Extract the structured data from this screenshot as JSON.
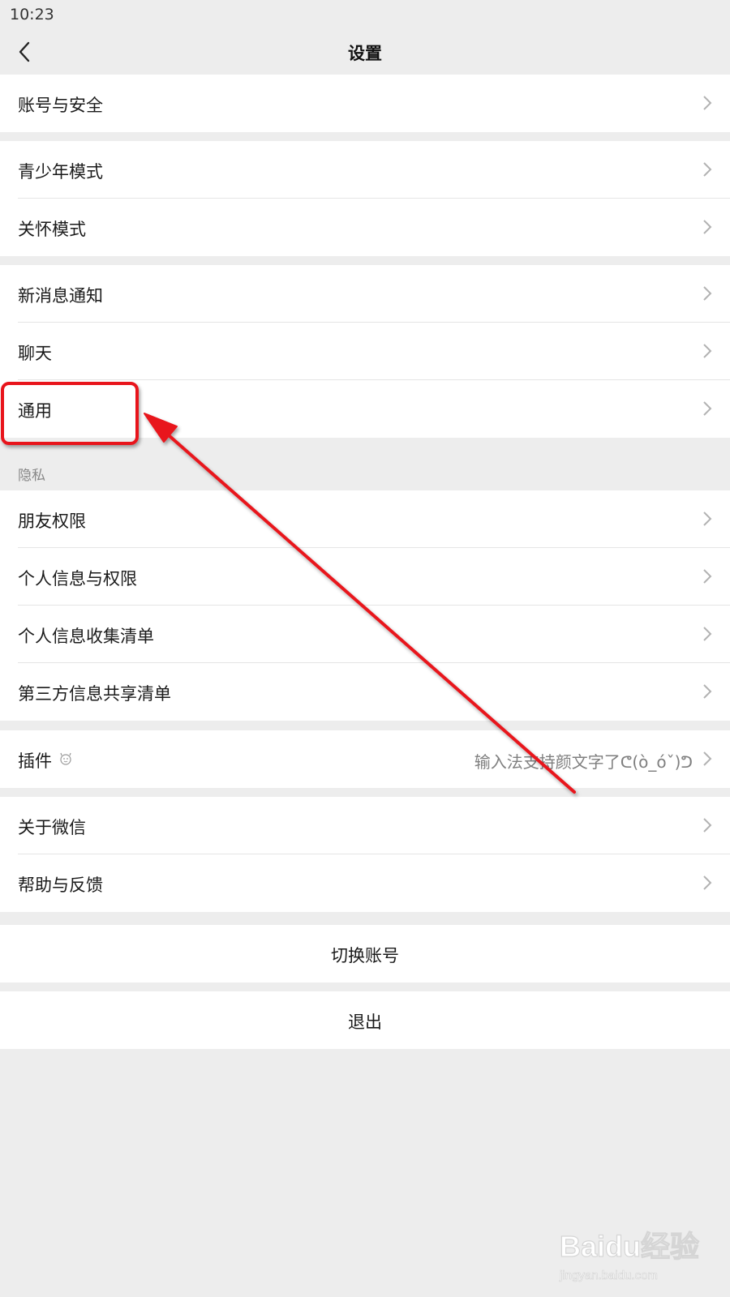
{
  "status_bar": {
    "time": "10:23"
  },
  "nav": {
    "title": "设置"
  },
  "items": {
    "account_security": "账号与安全",
    "teen_mode": "青少年模式",
    "care_mode": "关怀模式",
    "new_message": "新消息通知",
    "chat": "聊天",
    "general": "通用",
    "privacy_header": "隐私",
    "friend_permission": "朋友权限",
    "personal_info": "个人信息与权限",
    "info_collection": "个人信息收集清单",
    "third_party": "第三方信息共享清单",
    "plugins": "插件",
    "plugins_subtitle": "输入法支持颜文字了ᕦ(ò_óˇ)ᕤ",
    "about": "关于微信",
    "help": "帮助与反馈"
  },
  "actions": {
    "switch_account": "切换账号",
    "logout": "退出"
  },
  "watermark": {
    "text": "Baidu经验",
    "url_text": "jingyan.baidu.com"
  },
  "colors": {
    "accent": "#e8141b",
    "background": "#ededed"
  }
}
